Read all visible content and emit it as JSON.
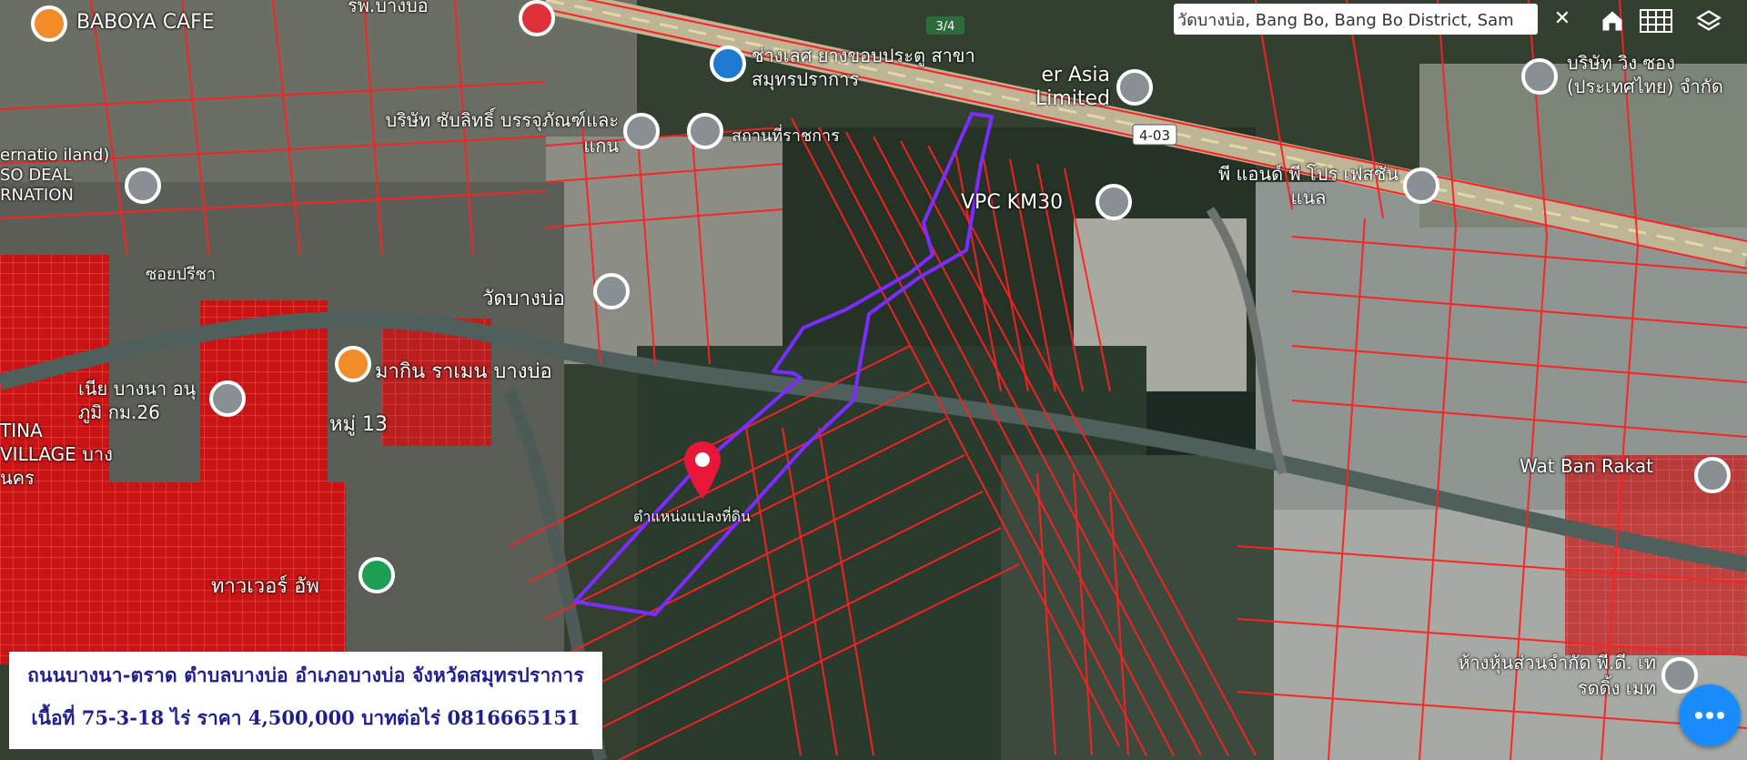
{
  "search": {
    "value": "วัดบางบ่อ, Bang Bo, Bang Bo District, Sam"
  },
  "controls": {
    "clear_icon": "close-icon",
    "home_icon": "home-icon",
    "grid_icon": "grid-icon",
    "layers_icon": "layers-icon",
    "chat_icon": "chat-bubble-icon"
  },
  "map": {
    "road_shield": "4-03",
    "road_shield_top": "3/4",
    "marker_label": "ตำแหน่งแปลงที่ดิน",
    "pois": [
      {
        "label": "BABOYA CAFE"
      },
      {
        "label": "รพ.บางบ่อ"
      },
      {
        "label": "ช่างเลศ ยางขอบประตู สาขาสมุทรปราการ"
      },
      {
        "label": "บริษัท ซับลิทธิ์ บรรจุภัณฑ์และแกน"
      },
      {
        "label": "สถานที่ราชการ"
      },
      {
        "label": "ernatio iland) SO DEAL RNATION"
      },
      {
        "label": "ซอยปรีชา"
      },
      {
        "label": "วัดบางบ่อ"
      },
      {
        "label": "er Asia Limited"
      },
      {
        "label": "VPC KM30"
      },
      {
        "label": "พี แอนด์ พี โปร เฟสชันแนล"
      },
      {
        "label": "บริษัท วิง ซอง (ประเทศไทย) จำกัด"
      },
      {
        "label": "มากิน ราเมน บางบ่อ"
      },
      {
        "label": "หมู่ 13"
      },
      {
        "label": "เนีย บางนา อนุภูมิ กม.26"
      },
      {
        "label": "TINA VILLAGE บางนคร"
      },
      {
        "label": "ทาวเวอร์ อัพ"
      },
      {
        "label": "Wat Ban Rakat"
      },
      {
        "label": "ห้างหุ้นส่วนจำกัด พี.ดี. เทรดดิ้ง เมท"
      }
    ]
  },
  "info": {
    "line1": "ถนนบางนา-ตราด  ตำบลบางบ่อ  อำเภอบางบ่อ  จังหวัดสมุทรปราการ",
    "line2": "เนื้อที่  75-3-18  ไร่   ราคา  4,500,000  บาทต่อไร่  0816665151"
  },
  "colors": {
    "parcel_line": "#ff1a1a",
    "plot_outline": "#7b2cff",
    "marker": "#e8173a",
    "info_text": "#1f1f8f",
    "chat_button": "#1a8cff"
  }
}
